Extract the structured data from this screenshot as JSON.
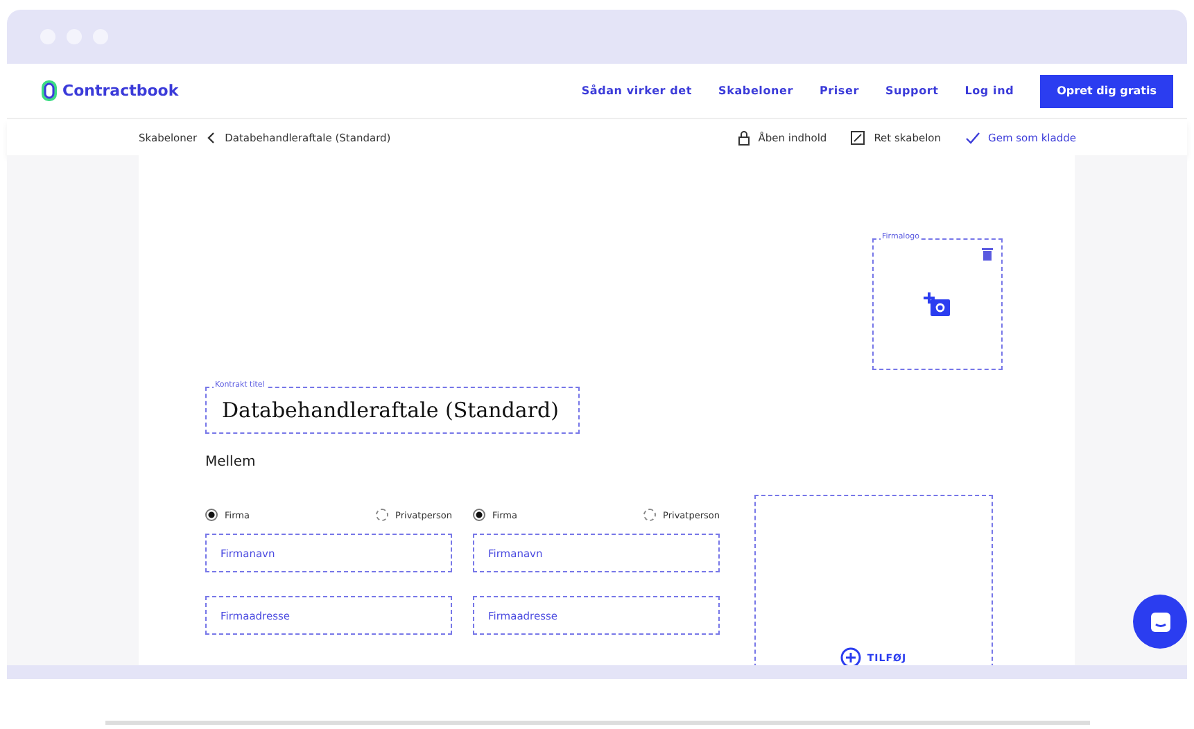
{
  "brand": {
    "name": "Contractbook"
  },
  "nav": {
    "links": [
      "Sådan virker det",
      "Skabeloner",
      "Priser",
      "Support",
      "Log ind"
    ],
    "cta": "Opret dig gratis"
  },
  "breadcrumb": {
    "parent": "Skabeloner",
    "current": "Databehandleraftale (Standard)"
  },
  "actions": [
    {
      "kind": "lock",
      "label": "Åben indhold"
    },
    {
      "kind": "edit",
      "label": "Ret skabelon"
    },
    {
      "kind": "check",
      "label": "Gem som kladde"
    }
  ],
  "logo_box": {
    "label": "Firmalogo"
  },
  "title_field": {
    "label": "Kontrakt titel",
    "value": "Databehandleraftale (Standard)"
  },
  "between_label": "Mellem",
  "parties": [
    {
      "options": [
        {
          "label": "Firma",
          "selected": true
        },
        {
          "label": "Privatperson",
          "selected": false
        }
      ],
      "fields": [
        {
          "placeholder": "Firmanavn"
        },
        {
          "placeholder": "Firmaadresse"
        }
      ]
    },
    {
      "options": [
        {
          "label": "Firma",
          "selected": true
        },
        {
          "label": "Privatperson",
          "selected": false
        }
      ],
      "fields": [
        {
          "placeholder": "Firmanavn"
        },
        {
          "placeholder": "Firmaadresse"
        }
      ]
    }
  ],
  "add_party": {
    "label": "TILFØJ"
  }
}
